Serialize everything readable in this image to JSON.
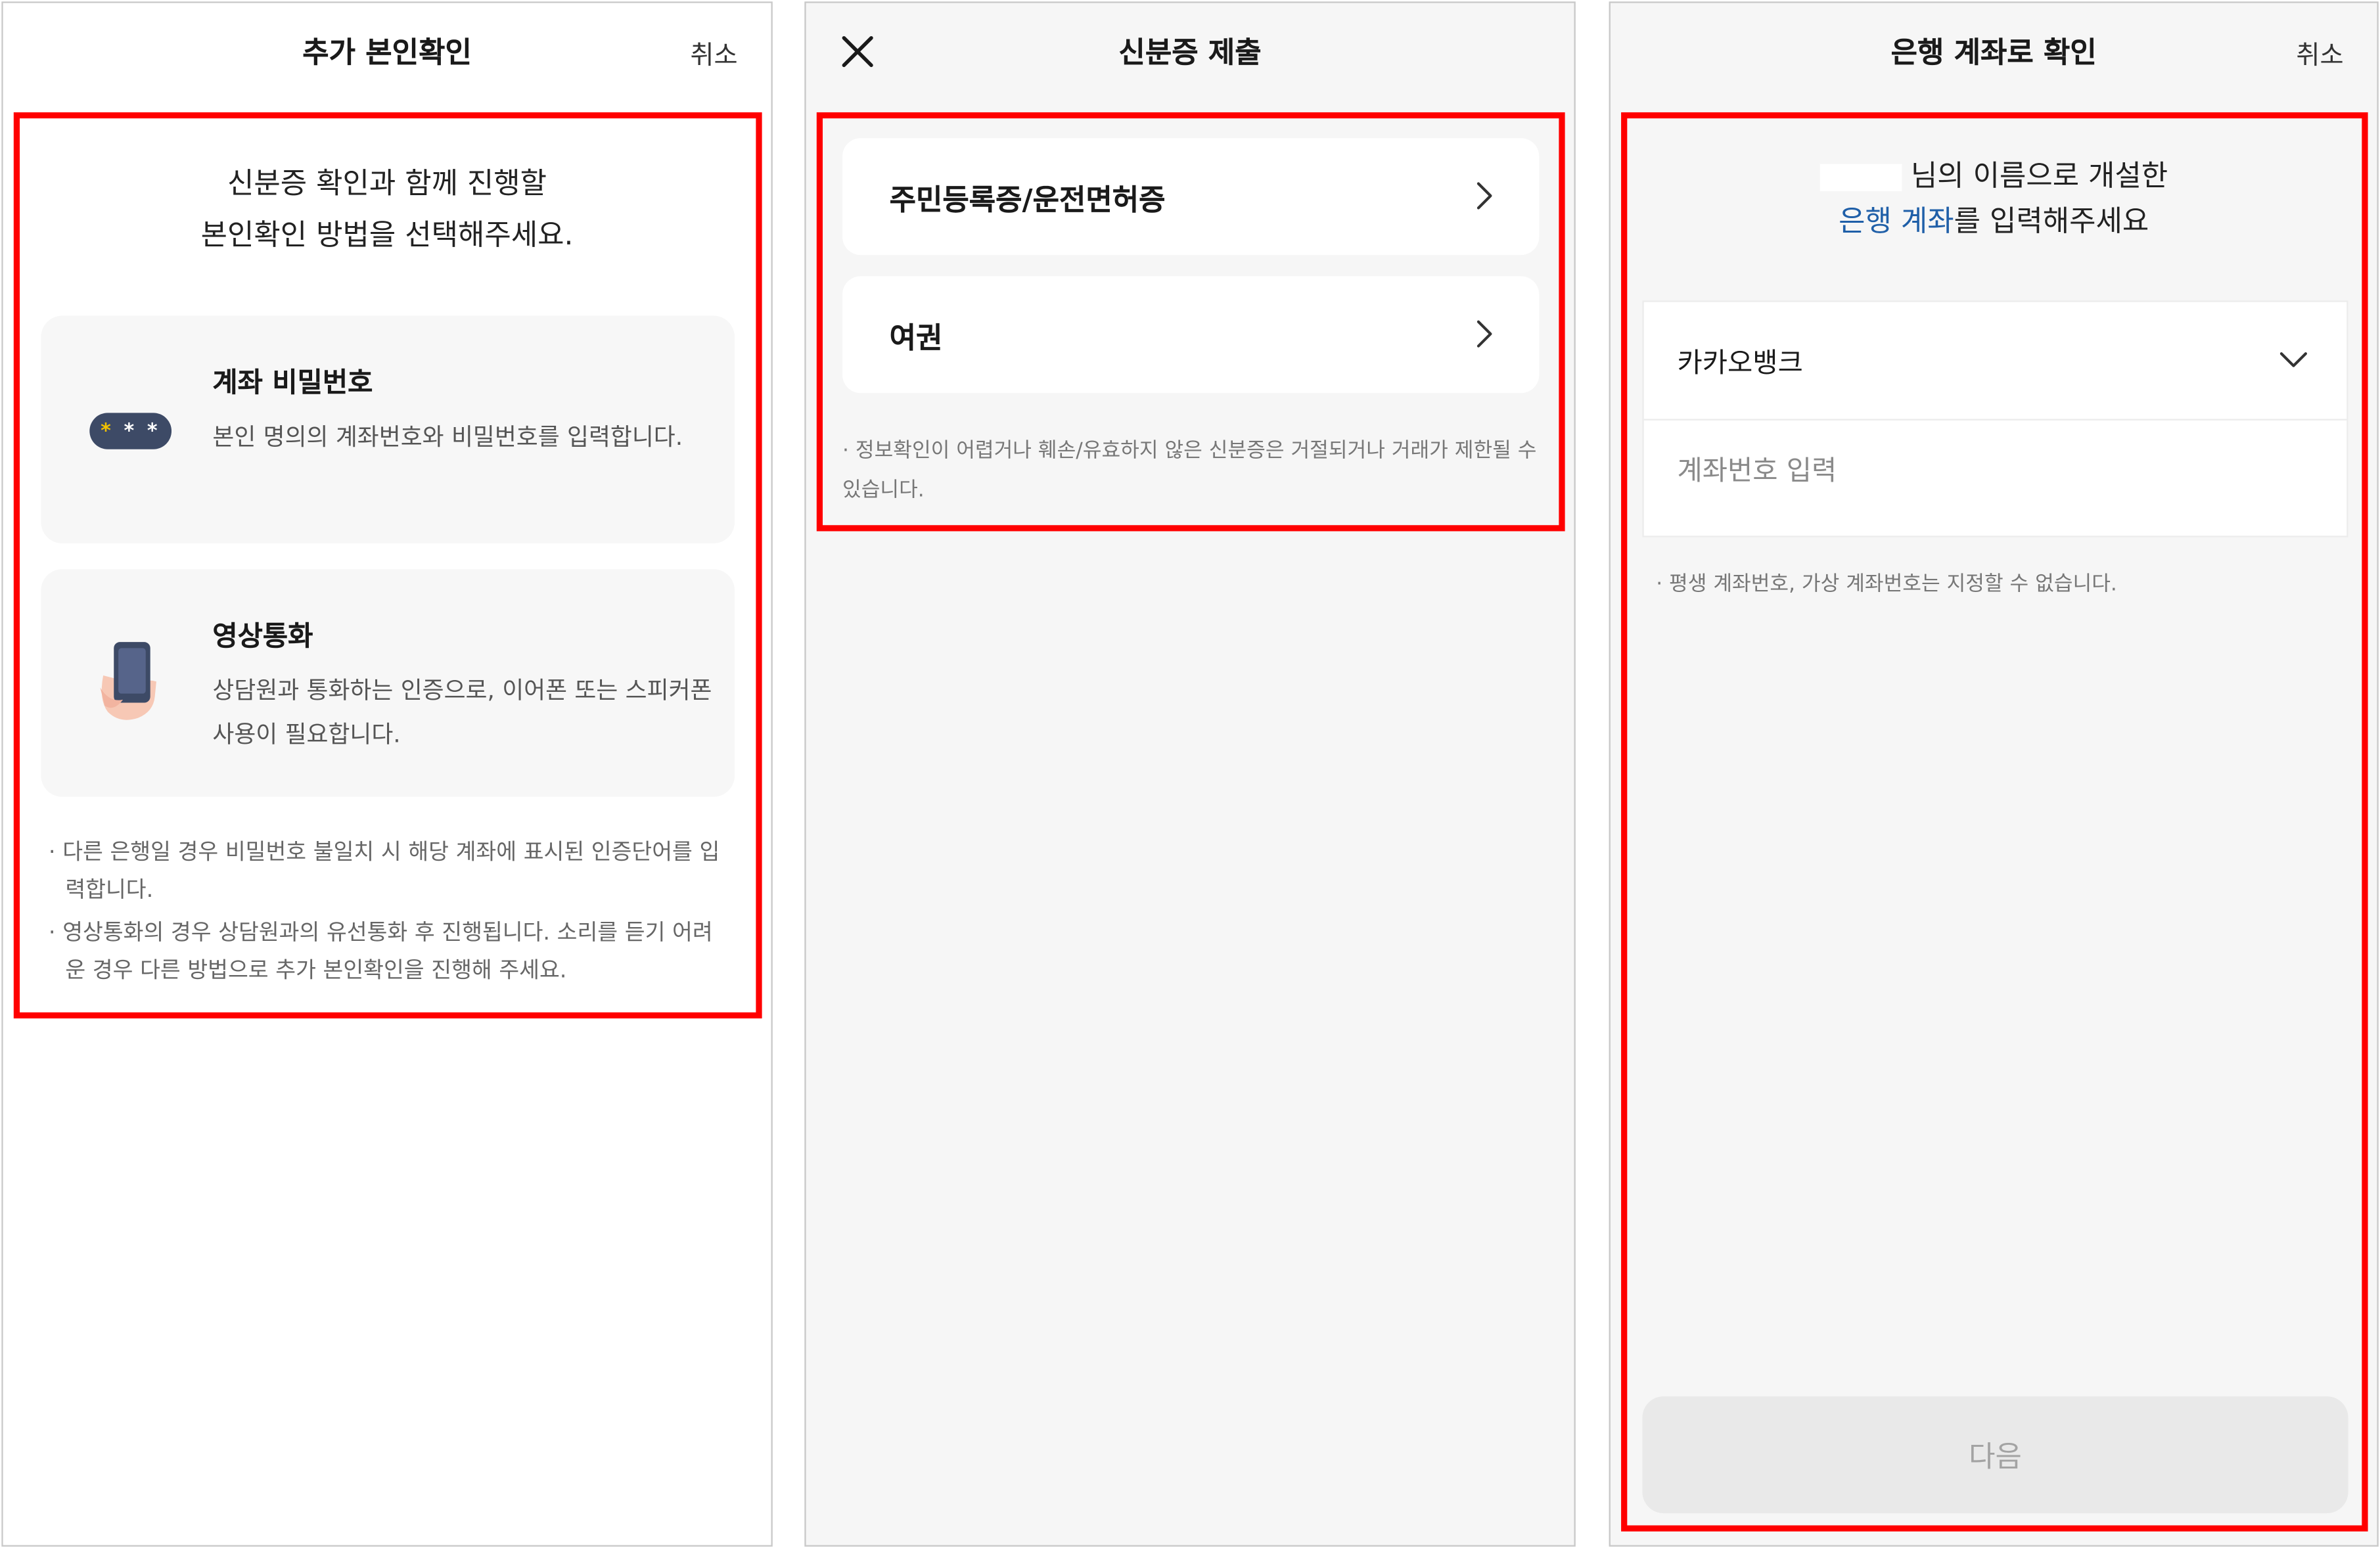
{
  "panel1": {
    "title": "추가 본인확인",
    "cancel_label": "취소",
    "intro_line1": "신분증 확인과 함께 진행할",
    "intro_line2": "본인확인 방법을 선택해주세요.",
    "options": [
      {
        "icon": "password-dots-icon",
        "icon_text": "* * *",
        "title": "계좌 비밀번호",
        "desc": "본인 명의의 계좌번호와 비밀번호를 입력합니다."
      },
      {
        "icon": "phone-in-hand-icon",
        "title": "영상통화",
        "desc": "상담원과 통화하는 인증으로, 이어폰 또는 스피커폰 사용이 필요합니다."
      }
    ],
    "notes": [
      "· 다른 은행일 경우 비밀번호 불일치 시 해당 계좌에 표시된 인증단어를 입력합니다.",
      "· 영상통화의 경우 상담원과의 유선통화 후 진행됩니다. 소리를 듣기 어려운 경우 다른 방법으로 추가 본인확인을 진행해 주세요."
    ]
  },
  "panel2": {
    "title": "신분증 제출",
    "close_icon": "close-icon",
    "items": [
      {
        "label": "주민등록증/운전면허증"
      },
      {
        "label": "여권"
      }
    ],
    "note": "· 정보확인이 어렵거나 훼손/유효하지 않은 신분증은 거절되거나 거래가 제한될 수 있습니다."
  },
  "panel3": {
    "title": "은행 계좌로 확인",
    "cancel_label": "취소",
    "intro_suffix": "님의 이름으로 개설한",
    "intro_accent": "은행 계좌",
    "intro_rest": "를 입력해주세요",
    "bank_selected": "카카오뱅크",
    "account_placeholder": "계좌번호 입력",
    "account_value": "",
    "note": "· 평생 계좌번호, 가상 계좌번호는 지정할 수 없습니다.",
    "next_label": "다음"
  },
  "colors": {
    "highlight_border": "#ff0000",
    "accent_link": "#1f5fa8",
    "icon_navy": "#3d4a66",
    "icon_star": "#f2c200"
  }
}
